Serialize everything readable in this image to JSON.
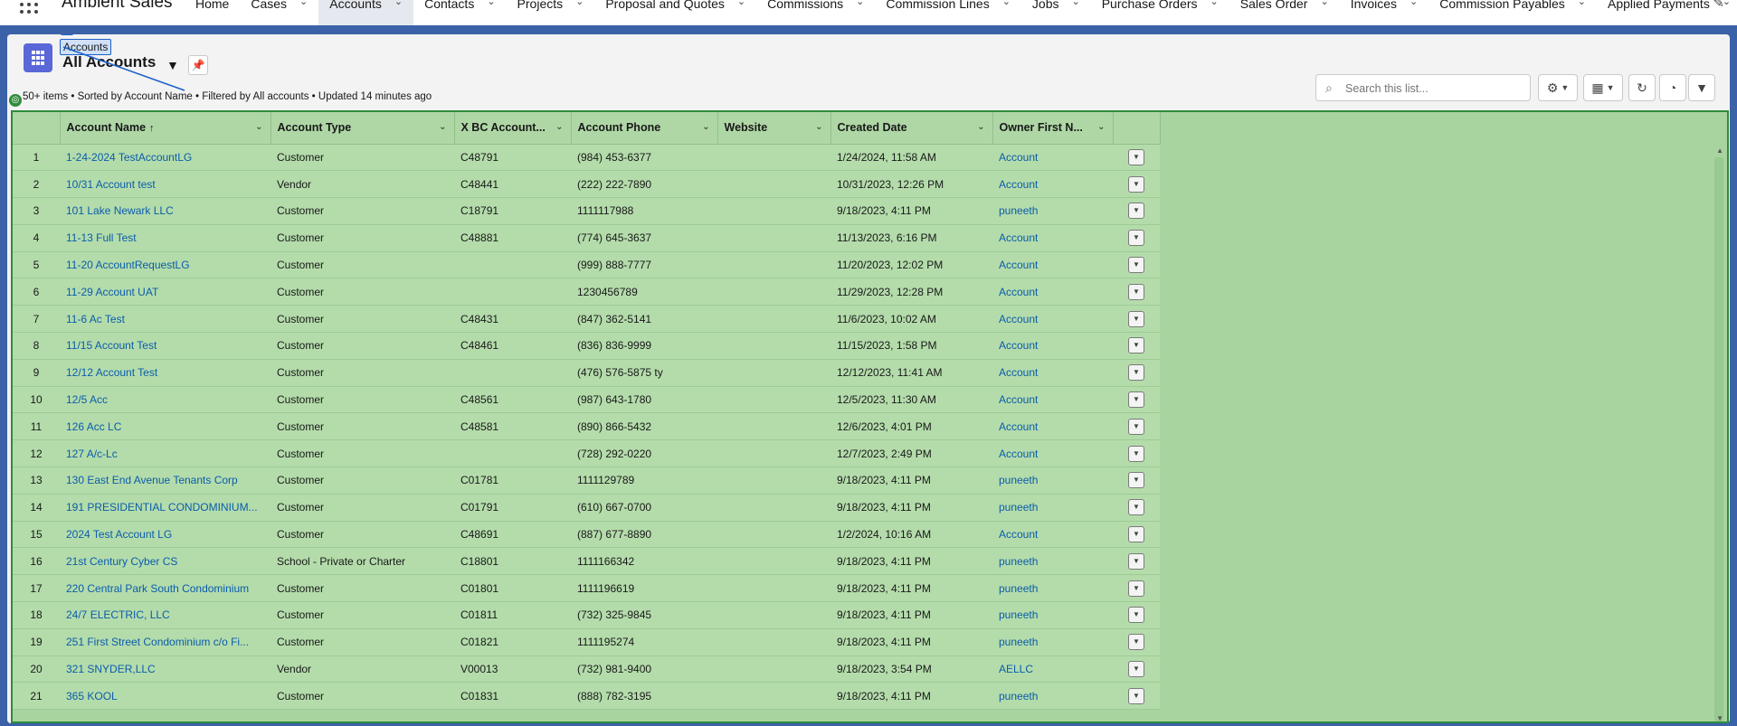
{
  "app": {
    "name": "Ambient Sales"
  },
  "nav": {
    "items": [
      {
        "label": "Home",
        "has_menu": false
      },
      {
        "label": "Cases",
        "has_menu": true
      },
      {
        "label": "Accounts",
        "has_menu": true,
        "active": true
      },
      {
        "label": "Contacts",
        "has_menu": true
      },
      {
        "label": "Projects",
        "has_menu": true
      },
      {
        "label": "Proposal and Quotes",
        "has_menu": true
      },
      {
        "label": "Commissions",
        "has_menu": true
      },
      {
        "label": "Commission Lines",
        "has_menu": true
      },
      {
        "label": "Jobs",
        "has_menu": true
      },
      {
        "label": "Purchase Orders",
        "has_menu": true
      },
      {
        "label": "Sales Order",
        "has_menu": true
      },
      {
        "label": "Invoices",
        "has_menu": true
      },
      {
        "label": "Commission Payables",
        "has_menu": true
      },
      {
        "label": "Applied Payments",
        "has_menu": true
      }
    ]
  },
  "header": {
    "object_label": "Accounts",
    "list_view_title": "All Accounts",
    "meta": "50+ items • Sorted by Account Name • Filtered by All accounts • Updated 14 minutes ago"
  },
  "search": {
    "placeholder": "Search this list..."
  },
  "icons": {
    "app_launcher": "waffle-icon",
    "object": "accounts-grid-icon",
    "pin": "pin-icon",
    "search": "search-icon",
    "settings": "gear-icon",
    "display": "table-display-icon",
    "refresh": "refresh-icon",
    "charts": "chart-icon",
    "filter": "filter-icon",
    "row_action": "chevron-down-icon",
    "edit_nav": "pencil-icon"
  },
  "colors": {
    "band": "#3b62a8",
    "link": "#0b5cab",
    "highlight_overlay": "#a8d4a0",
    "highlight_border": "#2e8b3a",
    "brand_icon": "#5a67d8"
  },
  "table": {
    "columns": [
      {
        "label": "Account Name",
        "sorted": "asc"
      },
      {
        "label": "Account Type"
      },
      {
        "label": "X BC Account..."
      },
      {
        "label": "Account Phone"
      },
      {
        "label": "Website"
      },
      {
        "label": "Created Date"
      },
      {
        "label": "Owner First N..."
      }
    ],
    "rows": [
      {
        "n": "1",
        "name": "1-24-2024 TestAccountLG",
        "type": "Customer",
        "bc": "C48791",
        "phone": "(984) 453-6377",
        "website": "",
        "created": "1/24/2024, 11:58 AM",
        "owner": "Account"
      },
      {
        "n": "2",
        "name": "10/31 Account test",
        "type": "Vendor",
        "bc": "C48441",
        "phone": "(222) 222-7890",
        "website": "",
        "created": "10/31/2023, 12:26 PM",
        "owner": "Account"
      },
      {
        "n": "3",
        "name": "101 Lake Newark LLC",
        "type": "Customer",
        "bc": "C18791",
        "phone": "1111117988",
        "website": "",
        "created": "9/18/2023, 4:11 PM",
        "owner": "puneeth"
      },
      {
        "n": "4",
        "name": "11-13 Full Test",
        "type": "Customer",
        "bc": "C48881",
        "phone": "(774) 645-3637",
        "website": "",
        "created": "11/13/2023, 6:16 PM",
        "owner": "Account"
      },
      {
        "n": "5",
        "name": "11-20 AccountRequestLG",
        "type": "Customer",
        "bc": "",
        "phone": "(999) 888-7777",
        "website": "",
        "created": "11/20/2023, 12:02 PM",
        "owner": "Account"
      },
      {
        "n": "6",
        "name": "11-29 Account UAT",
        "type": "Customer",
        "bc": "",
        "phone": "1230456789",
        "website": "",
        "created": "11/29/2023, 12:28 PM",
        "owner": "Account"
      },
      {
        "n": "7",
        "name": "11-6 Ac Test",
        "type": "Customer",
        "bc": "C48431",
        "phone": "(847) 362-5141",
        "website": "",
        "created": "11/6/2023, 10:02 AM",
        "owner": "Account"
      },
      {
        "n": "8",
        "name": "11/15 Account Test",
        "type": "Customer",
        "bc": "C48461",
        "phone": "(836) 836-9999",
        "website": "",
        "created": "11/15/2023, 1:58 PM",
        "owner": "Account"
      },
      {
        "n": "9",
        "name": "12/12 Account Test",
        "type": "Customer",
        "bc": "",
        "phone": "(476) 576-5875 ty",
        "website": "",
        "created": "12/12/2023, 11:41 AM",
        "owner": "Account"
      },
      {
        "n": "10",
        "name": "12/5 Acc",
        "type": "Customer",
        "bc": "C48561",
        "phone": "(987) 643-1780",
        "website": "",
        "created": "12/5/2023, 11:30 AM",
        "owner": "Account"
      },
      {
        "n": "11",
        "name": "126 Acc LC",
        "type": "Customer",
        "bc": "C48581",
        "phone": "(890) 866-5432",
        "website": "",
        "created": "12/6/2023, 4:01 PM",
        "owner": "Account"
      },
      {
        "n": "12",
        "name": "127 A/c-Lc",
        "type": "Customer",
        "bc": "",
        "phone": "(728) 292-0220",
        "website": "",
        "created": "12/7/2023, 2:49 PM",
        "owner": "Account"
      },
      {
        "n": "13",
        "name": "130 East End Avenue Tenants Corp",
        "type": "Customer",
        "bc": "C01781",
        "phone": "1111129789",
        "website": "",
        "created": "9/18/2023, 4:11 PM",
        "owner": "puneeth"
      },
      {
        "n": "14",
        "name": "191 PRESIDENTIAL CONDOMINIUM...",
        "type": "Customer",
        "bc": "C01791",
        "phone": "(610) 667-0700",
        "website": "",
        "created": "9/18/2023, 4:11 PM",
        "owner": "puneeth"
      },
      {
        "n": "15",
        "name": "2024 Test Account LG",
        "type": "Customer",
        "bc": "C48691",
        "phone": "(887) 677-8890",
        "website": "",
        "created": "1/2/2024, 10:16 AM",
        "owner": "Account"
      },
      {
        "n": "16",
        "name": "21st Century Cyber CS",
        "type": "School - Private or Charter",
        "bc": "C18801",
        "phone": "1111166342",
        "website": "",
        "created": "9/18/2023, 4:11 PM",
        "owner": "puneeth"
      },
      {
        "n": "17",
        "name": "220 Central Park South Condominium",
        "type": "Customer",
        "bc": "C01801",
        "phone": "1111196619",
        "website": "",
        "created": "9/18/2023, 4:11 PM",
        "owner": "puneeth"
      },
      {
        "n": "18",
        "name": "24/7 ELECTRIC, LLC",
        "type": "Customer",
        "bc": "C01811",
        "phone": "(732) 325-9845",
        "website": "",
        "created": "9/18/2023, 4:11 PM",
        "owner": "puneeth"
      },
      {
        "n": "19",
        "name": "251 First Street Condominium c/o Fi...",
        "type": "Customer",
        "bc": "C01821",
        "phone": "1111195274",
        "website": "",
        "created": "9/18/2023, 4:11 PM",
        "owner": "puneeth"
      },
      {
        "n": "20",
        "name": "321 SNYDER,LLC",
        "type": "Vendor",
        "bc": "V00013",
        "phone": "(732) 981-9400",
        "website": "",
        "created": "9/18/2023, 3:54 PM",
        "owner": "AELLC"
      },
      {
        "n": "21",
        "name": "365 KOOL",
        "type": "Customer",
        "bc": "C01831",
        "phone": "(888) 782-3195",
        "website": "",
        "created": "9/18/2023, 4:11 PM",
        "owner": "puneeth"
      }
    ]
  }
}
